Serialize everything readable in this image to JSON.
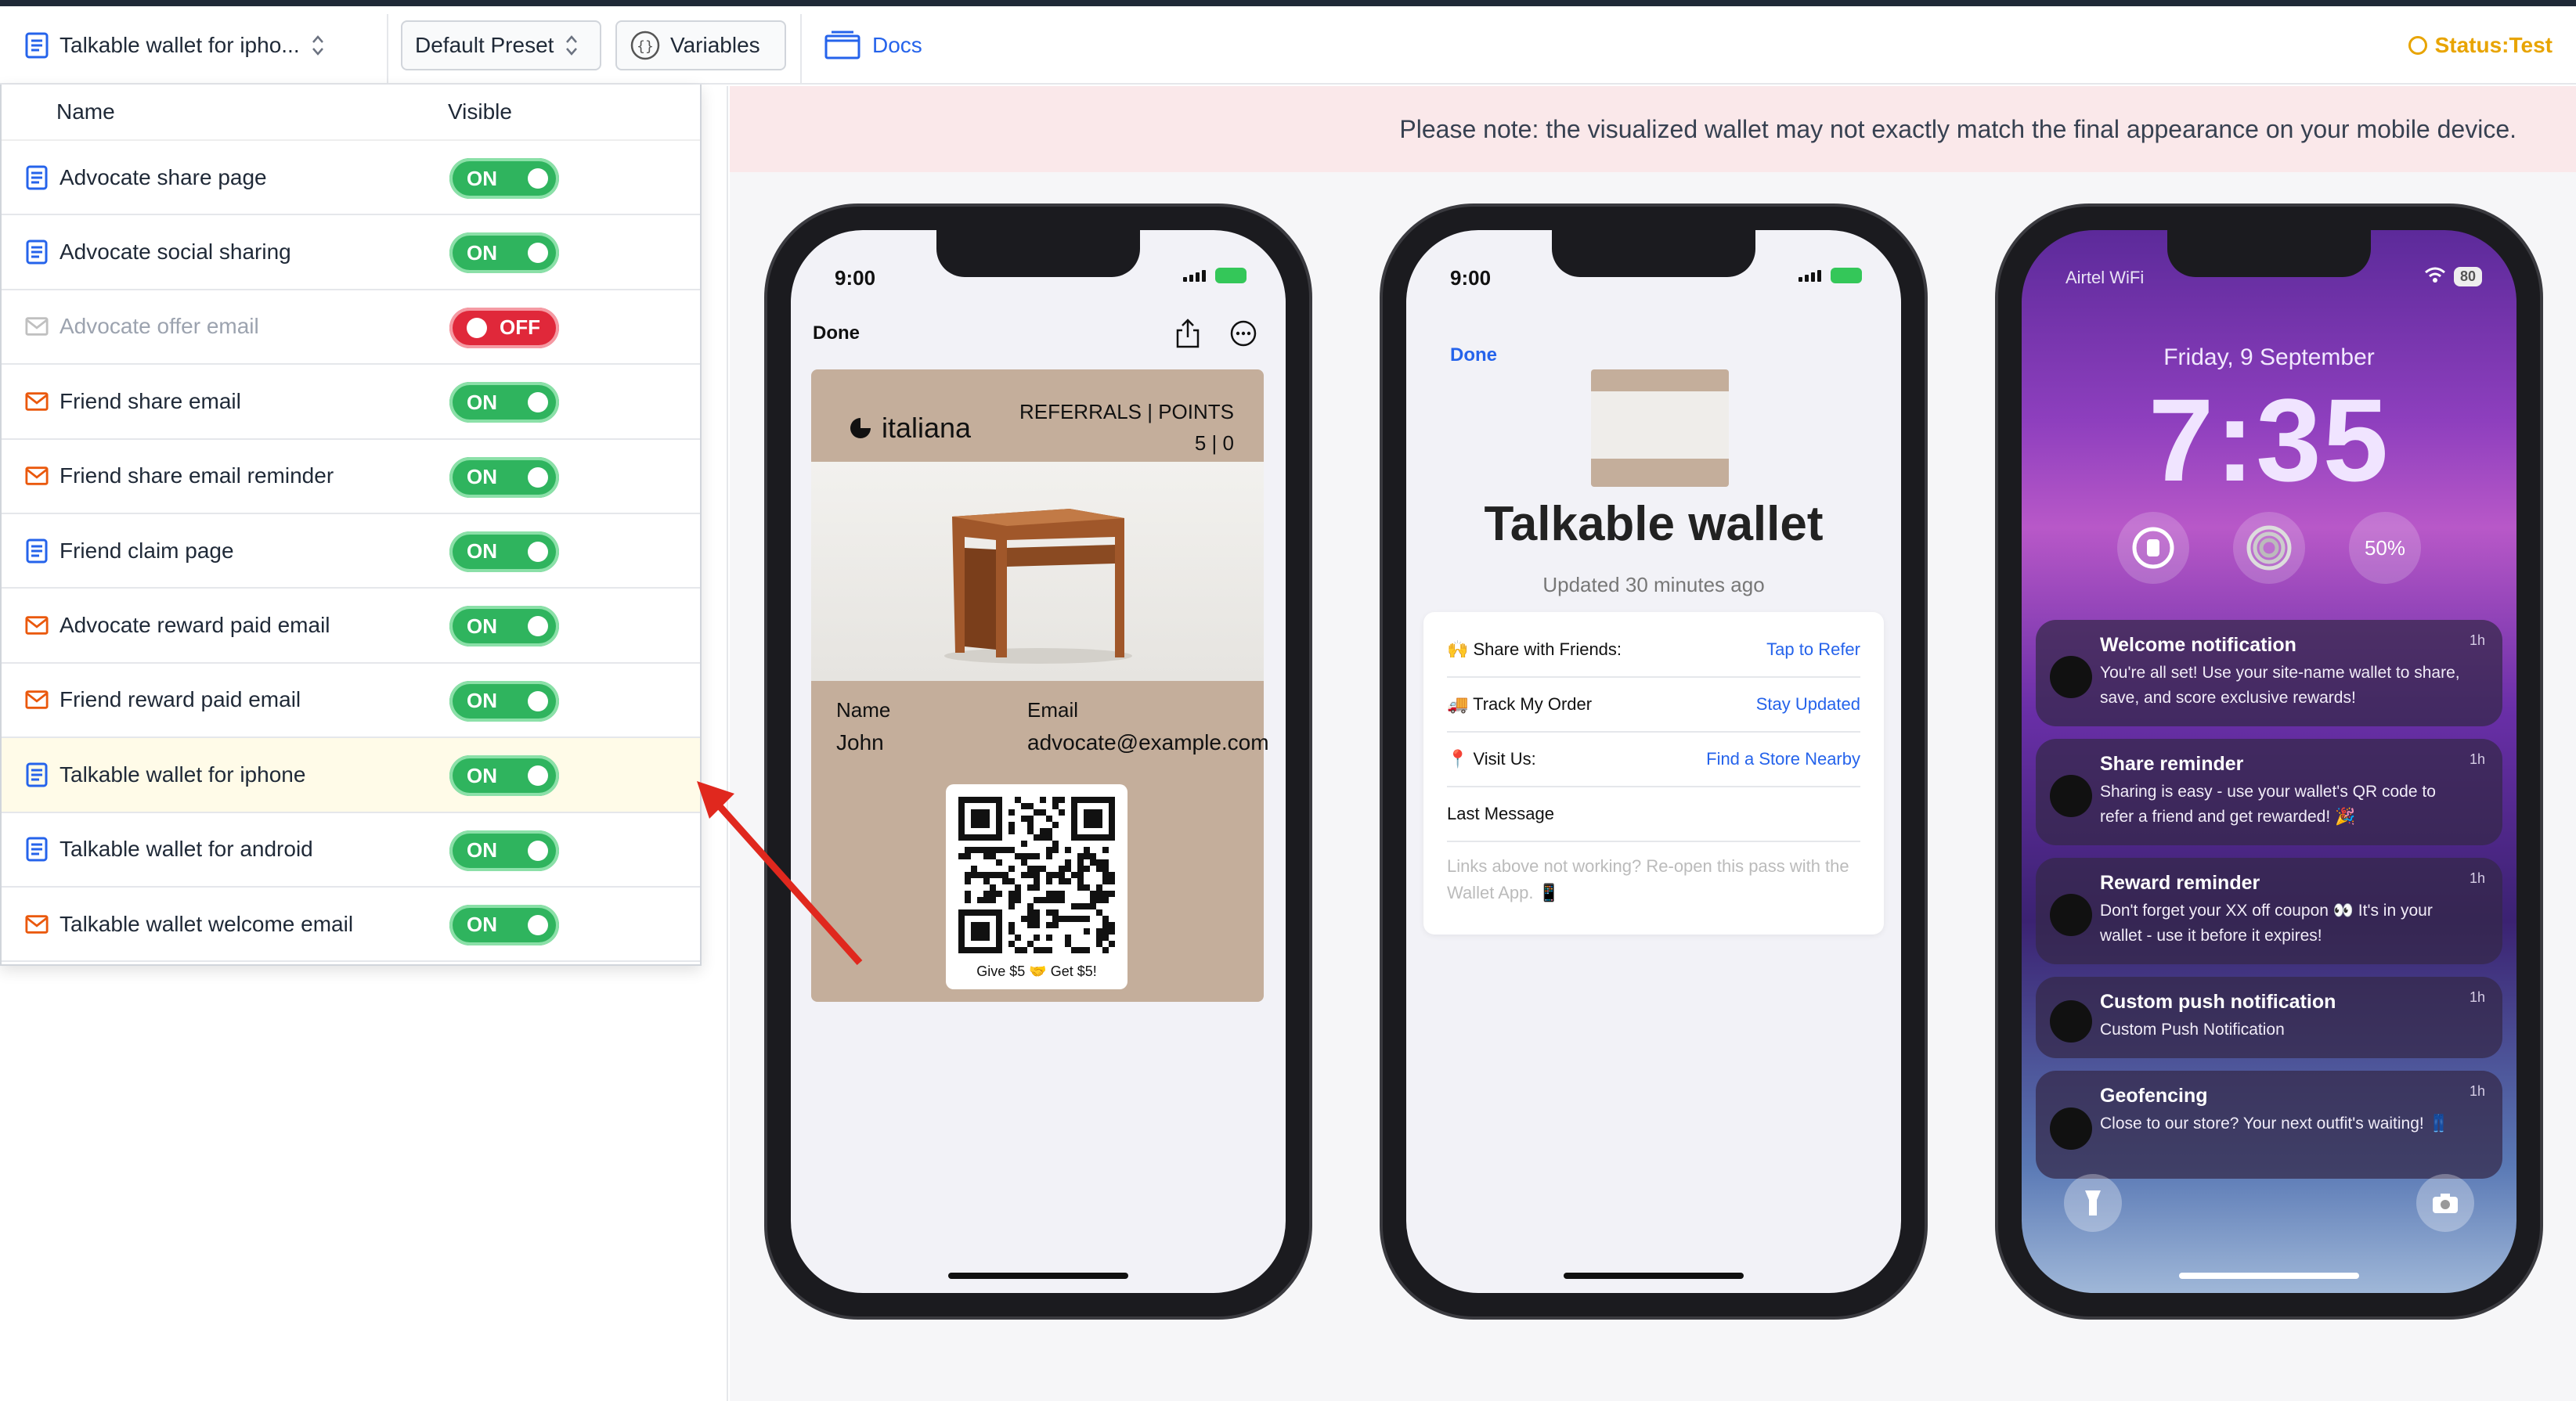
{
  "toolbar": {
    "template_select": "Talkable wallet for ipho...",
    "preset_select": "Default Preset",
    "variables_label": "Variables",
    "docs_label": "Docs",
    "status_label": "Status:Test"
  },
  "dropdown": {
    "col_name": "Name",
    "col_visible": "Visible",
    "items": [
      {
        "label": "Advocate share page",
        "type": "page",
        "state": "ON"
      },
      {
        "label": "Advocate social sharing",
        "type": "page",
        "state": "ON"
      },
      {
        "label": "Advocate offer email",
        "type": "email",
        "state": "OFF"
      },
      {
        "label": "Friend share email",
        "type": "email",
        "state": "ON"
      },
      {
        "label": "Friend share email reminder",
        "type": "email",
        "state": "ON"
      },
      {
        "label": "Friend claim page",
        "type": "page",
        "state": "ON"
      },
      {
        "label": "Advocate reward paid email",
        "type": "email",
        "state": "ON"
      },
      {
        "label": "Friend reward paid email",
        "type": "email",
        "state": "ON"
      },
      {
        "label": "Talkable wallet for iphone",
        "type": "page",
        "state": "ON"
      },
      {
        "label": "Talkable wallet for android",
        "type": "page",
        "state": "ON"
      },
      {
        "label": "Talkable wallet welcome email",
        "type": "email",
        "state": "ON"
      }
    ]
  },
  "banner": {
    "text": "Please note: the visualized wallet may not exactly match the final appearance on your mobile device."
  },
  "phone1": {
    "time": "9:00",
    "done": "Done",
    "brand": "italiana",
    "ref_title": "REFERRALS | POINTS",
    "ref_values": "5 | 0",
    "name_label": "Name",
    "name_value": "John",
    "email_label": "Email",
    "email_value": "advocate@example.com",
    "qr_caption": "Give $5 🤝 Get $5!"
  },
  "phone2": {
    "time": "9:00",
    "done": "Done",
    "title": "Talkable wallet",
    "updated": "Updated 30 minutes ago",
    "rows": [
      {
        "label": "🙌 Share with Friends:",
        "link": "Tap to Refer"
      },
      {
        "label": "🚚 Track My Order",
        "link": "Stay Updated"
      },
      {
        "label": "📍 Visit Us:",
        "link": "Find a Store Nearby"
      },
      {
        "label": "Last Message",
        "link": ""
      }
    ],
    "note": "Links above not working? Re-open this pass with the Wallet App. 📱"
  },
  "phone3": {
    "carrier": "Airtel WiFi",
    "battery": "80",
    "date": "Friday, 9 September",
    "time": "7:35",
    "widget_pct": "50%",
    "notifications": [
      {
        "title": "Welcome notification",
        "body": "You're all set! Use your site-name wallet to share, save, and score exclusive rewards!",
        "age": "1h"
      },
      {
        "title": "Share reminder",
        "body": "Sharing is easy - use your wallet's QR code to refer a friend and get rewarded! 🎉",
        "age": "1h"
      },
      {
        "title": "Reward reminder",
        "body": "Don't forget your XX off coupon 👀 It's in your wallet - use it before it expires!",
        "age": "1h"
      },
      {
        "title": "Custom push notification",
        "body": "Custom Push Notification",
        "age": "1h"
      },
      {
        "title": "Geofencing",
        "body": "Close to our store? Your next outfit's waiting! 👖",
        "age": "1h"
      }
    ]
  },
  "colors": {
    "on": "#2fb45e",
    "off": "#e0283a",
    "link": "#2563eb",
    "status": "#e8a400",
    "banner_bg": "#fae8ea"
  }
}
